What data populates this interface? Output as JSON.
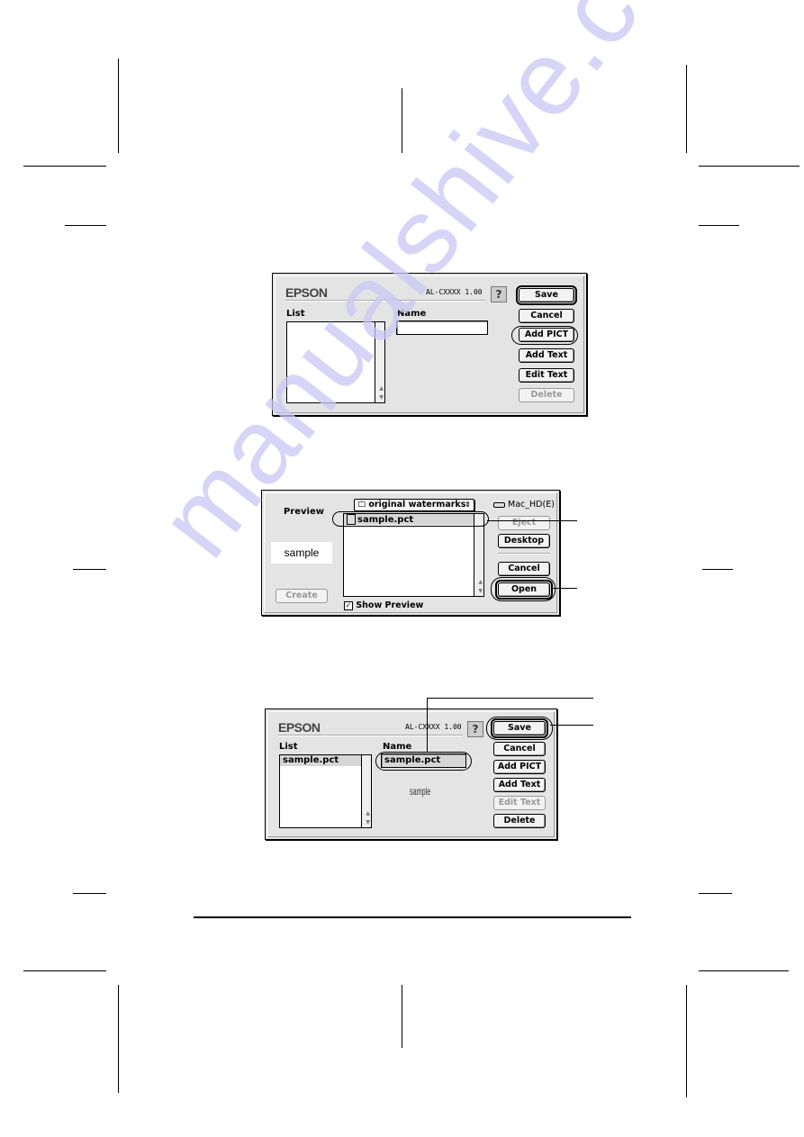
{
  "watermark": "manualshive.com",
  "dialog1": {
    "brand": "EPSON",
    "version": "AL-CXXXX  1.00",
    "help_label": "?",
    "list_label": "List",
    "name_label": "Name",
    "name_value": "",
    "buttons": {
      "save": "Save",
      "cancel": "Cancel",
      "add_pict": "Add PICT",
      "add_text": "Add Text",
      "edit_text": "Edit Text",
      "delete": "Delete"
    }
  },
  "dialog2": {
    "preview_label": "Preview",
    "preview_text": "sample",
    "folder_popup": "original watermarks",
    "volume": "Mac_HD(E)",
    "files": [
      "sample.pct"
    ],
    "show_preview_label": "Show Preview",
    "show_preview_checked": true,
    "buttons": {
      "eject": "Eject",
      "desktop": "Desktop",
      "cancel": "Cancel",
      "open": "Open",
      "create": "Create"
    }
  },
  "dialog3": {
    "brand": "EPSON",
    "version": "AL-CXXXX  1.00",
    "help_label": "?",
    "list_label": "List",
    "name_label": "Name",
    "list_items": [
      "sample.pct"
    ],
    "name_value": "sample.pct",
    "preview_text": "sample",
    "buttons": {
      "save": "Save",
      "cancel": "Cancel",
      "add_pict": "Add PICT",
      "add_text": "Add Text",
      "edit_text": "Edit Text",
      "delete": "Delete"
    }
  }
}
